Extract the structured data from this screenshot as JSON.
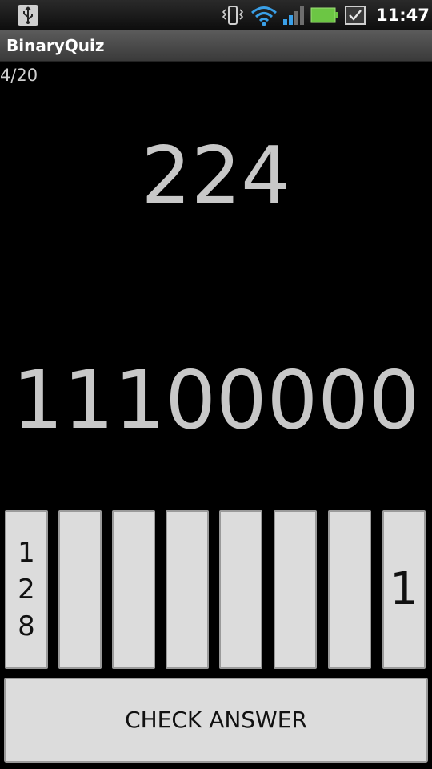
{
  "status_bar": {
    "time": "11:47",
    "icons": [
      "usb-icon",
      "vibrate-icon",
      "wifi-icon",
      "signal-icon",
      "battery-icon",
      "checkbox-icon"
    ],
    "accent_wifi": "#3aa0e8",
    "battery_color": "#6cc644"
  },
  "app": {
    "title": "BinaryQuiz"
  },
  "quiz": {
    "progress": "4/20",
    "decimal": "224",
    "binary": "11100000"
  },
  "bits": [
    {
      "label": "128"
    },
    {
      "label": ""
    },
    {
      "label": ""
    },
    {
      "label": ""
    },
    {
      "label": ""
    },
    {
      "label": ""
    },
    {
      "label": ""
    },
    {
      "label": "1"
    }
  ],
  "actions": {
    "check_label": "CHECK ANSWER"
  }
}
